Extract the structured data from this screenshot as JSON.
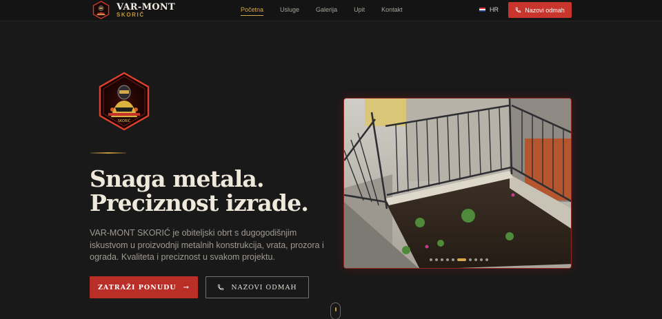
{
  "brand": {
    "title": "VAR-MONT",
    "subtitle": "SKORIĆ"
  },
  "nav": {
    "items": [
      {
        "label": "Početna",
        "active": true
      },
      {
        "label": "Usluge",
        "active": false
      },
      {
        "label": "Galerija",
        "active": false
      },
      {
        "label": "Upit",
        "active": false
      },
      {
        "label": "Kontakt",
        "active": false
      }
    ]
  },
  "language": {
    "code": "HR",
    "flag_icon": "croatia-flag-icon"
  },
  "header_cta": {
    "label": "Nazovi odmah",
    "icon": "phone-icon",
    "color": "#c7352d"
  },
  "hero": {
    "headline_line1": "Snaga metala.",
    "headline_line2": "Preciznost izrade.",
    "intro": "VAR-MONT SKORIĆ je obiteljski obrt s dugogodišnjim iskustvom u proizvodnji metalnih konstrukcija, vrata, prozora i ograda. Kvaliteta i preciznost u svakom projektu.",
    "primary_button": "ZATRAŽI PONUDU",
    "secondary_button": "NAZOVI ODMAH"
  },
  "gallery": {
    "slide_count": 10,
    "active_slide": 5
  },
  "colors": {
    "accent_gold": "#d6a84c",
    "accent_red": "#b92f28",
    "background": "#191919"
  }
}
